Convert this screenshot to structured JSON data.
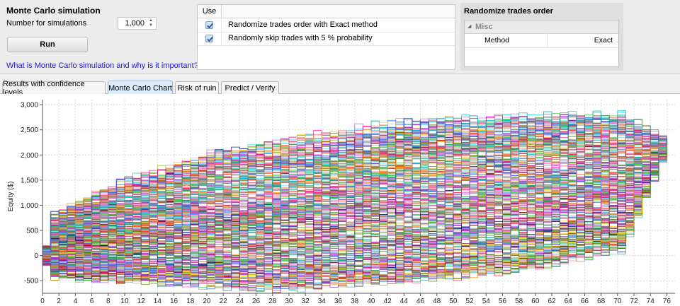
{
  "settings": {
    "title": "Monte Carlo simulation",
    "num_label": "Number for simulations",
    "num_value": "1,000",
    "run_label": "Run",
    "help_link": "What is Monte Carlo simulation and why is it important?"
  },
  "methods": {
    "header_use": "Use",
    "rows": [
      {
        "label": "Randomize trades order with Exact method",
        "checked": true
      },
      {
        "label": "Randomly skip trades with 5 % probability",
        "checked": true
      }
    ]
  },
  "properties": {
    "title": "Randomize trades order",
    "category": "Misc",
    "row_name": "Method",
    "row_value": "Exact"
  },
  "tabs": [
    {
      "label": "Results with confidence levels",
      "active": false
    },
    {
      "label": "Monte Carlo Chart",
      "active": true
    },
    {
      "label": "Risk of ruin",
      "active": false
    },
    {
      "label": "Predict / Verify",
      "active": false
    }
  ],
  "chart_data": {
    "type": "line",
    "ylabel": "Equity ($)",
    "xlim": [
      0,
      77
    ],
    "ylim": [
      -750,
      3100
    ],
    "y_ticks": [
      -500,
      0,
      500,
      1000,
      1500,
      2000,
      2500,
      3000
    ],
    "y_tick_labels": [
      "-500",
      "0",
      "500",
      "1,000",
      "1,500",
      "2,000",
      "2,500",
      "3,000"
    ],
    "x_ticks": [
      0,
      2,
      4,
      6,
      8,
      10,
      12,
      14,
      16,
      18,
      20,
      22,
      24,
      26,
      28,
      30,
      32,
      34,
      36,
      38,
      40,
      42,
      44,
      46,
      48,
      50,
      52,
      54,
      56,
      58,
      60,
      62,
      64,
      66,
      68,
      70,
      72,
      74,
      76
    ],
    "x_tick_labels": [
      "0",
      "2",
      "4",
      "6",
      "8",
      "10",
      "12",
      "14",
      "16",
      "18",
      "20",
      "22",
      "24",
      "26",
      "28",
      "30",
      "32",
      "34",
      "36",
      "38",
      "40",
      "42",
      "44",
      "46",
      "48",
      "50",
      "52",
      "54",
      "56",
      "58",
      "60",
      "62",
      "64",
      "66",
      "68",
      "70",
      "72",
      "74",
      "76"
    ],
    "grid": true,
    "simulations": 1000,
    "start_value": 0,
    "end_value": 2250,
    "final_x": 76,
    "simulated_band": {
      "x": [
        0,
        10,
        20,
        30,
        40,
        50,
        60,
        70,
        76
      ],
      "upper": [
        700,
        1500,
        2000,
        2300,
        2600,
        2700,
        2750,
        2800,
        2250
      ],
      "lower": [
        -400,
        -500,
        -600,
        -650,
        -500,
        -400,
        -200,
        100,
        2250
      ]
    },
    "series_colors": [
      "#e6194b",
      "#3cb44b",
      "#ffd400",
      "#4363d8",
      "#f58231",
      "#911eb4",
      "#42d4f4",
      "#f032e6",
      "#9acd32",
      "#ff69b4",
      "#469990",
      "#b57edc",
      "#9a6324",
      "#800000",
      "#00c87a",
      "#808000",
      "#ff7f50",
      "#000075",
      "#1e90ff",
      "#ff1493",
      "#32cd32",
      "#ff8c00",
      "#8a2be2",
      "#00ced1",
      "#dc143c",
      "#6b8e23",
      "#ba55d3",
      "#20b2aa",
      "#2e8b57",
      "#ff4500",
      "#4169e1",
      "#c71585"
    ]
  }
}
